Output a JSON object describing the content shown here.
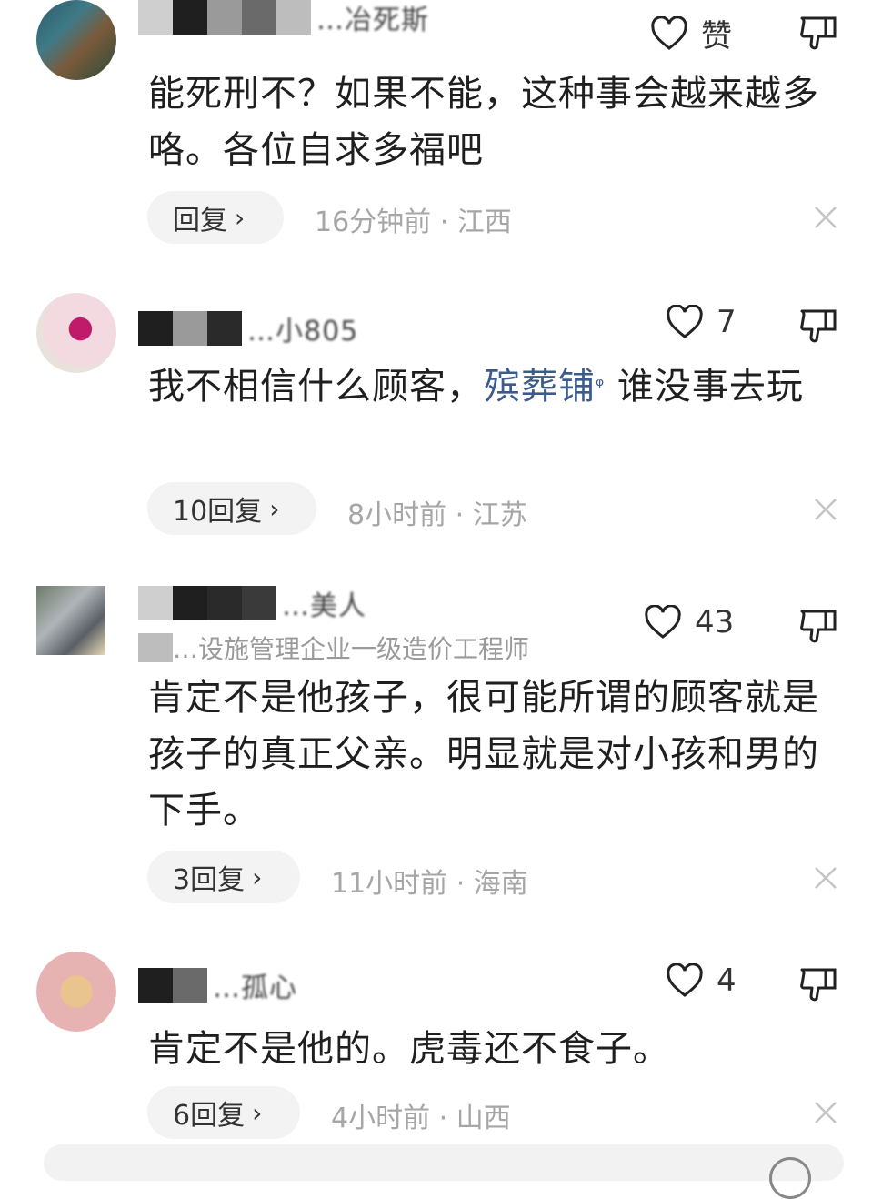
{
  "comments": [
    {
      "username": "…冶死斯",
      "subtitle": "",
      "like_label": "赞",
      "text": "能死刑不？如果不能，这种事会越来越多咯。各位自求多福吧",
      "reply_label": "回复",
      "time": "16分钟前 · 江西"
    },
    {
      "username": "…小805",
      "subtitle": "",
      "like_label": "7",
      "text_before": "我不相信什么顾客，",
      "text_link": "殡葬铺",
      "text_after": " 谁没事去玩",
      "reply_label": "10回复",
      "time": "8小时前 · 江苏"
    },
    {
      "username": "…美人",
      "subtitle": "…设施管理企业一级造价工程师",
      "like_label": "43",
      "text": "肯定不是他孩子，很可能所谓的顾客就是孩子的真正父亲。明显就是对小孩和男的下手。",
      "reply_label": "3回复",
      "time": "11小时前 · 海南"
    },
    {
      "username": "…孤心",
      "subtitle": "",
      "like_label": "4",
      "text": "肯定不是他的。虎毒还不食子。",
      "reply_label": "6回复",
      "time": "4小时前 · 山西"
    }
  ]
}
